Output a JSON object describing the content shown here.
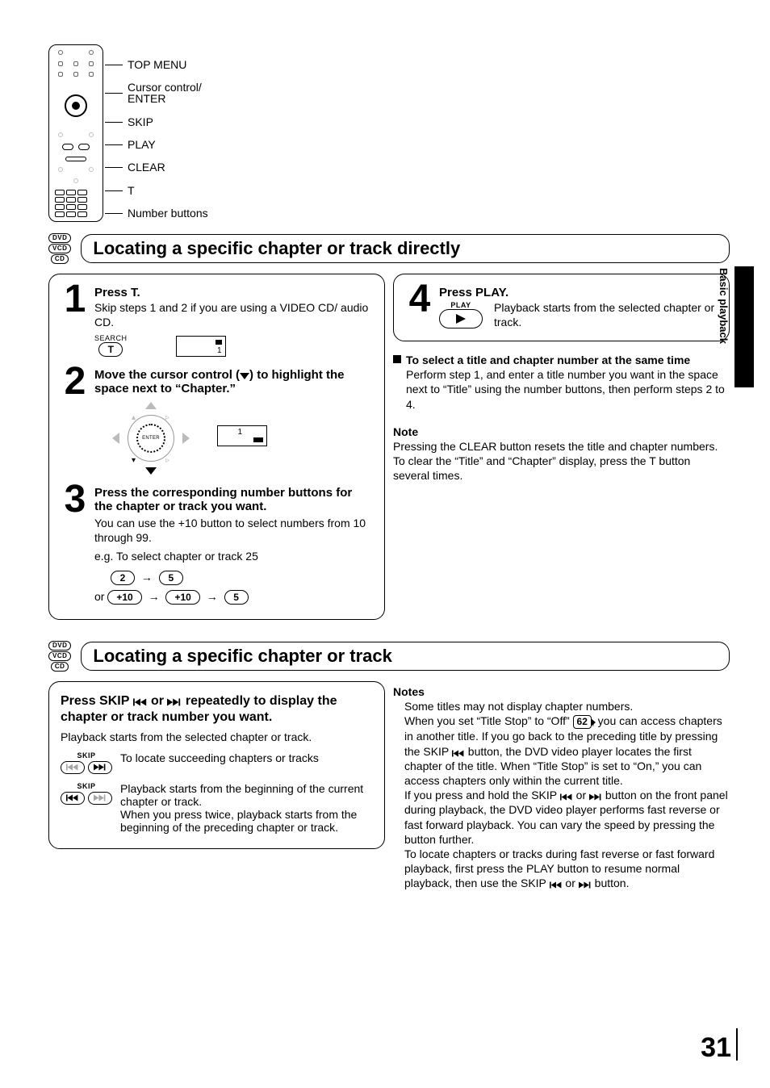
{
  "remote_labels": {
    "top_menu": "TOP MENU",
    "cursor": "Cursor control/\nENTER",
    "skip": "SKIP",
    "play": "PLAY",
    "clear": "CLEAR",
    "t": "T",
    "numbers": "Number buttons"
  },
  "badges": {
    "dvd": "DVD",
    "vcd": "VCD",
    "cd": "CD"
  },
  "section1": {
    "title": "Locating a specific chapter or track directly",
    "step1": {
      "num": "1",
      "head": "Press T.",
      "body": "Skip steps 1 and 2 if you are using a VIDEO CD/ audio CD.",
      "search": "SEARCH",
      "key": "T",
      "disp_num": "1"
    },
    "step2": {
      "num": "2",
      "head_a": "Move the cursor control (",
      "head_b": ") to highlight the space next to “Chapter.”",
      "enter": "ENTER",
      "disp_num": "1"
    },
    "step3": {
      "num": "3",
      "head": "Press the corresponding number buttons for the chapter or track you want.",
      "body1": "You can use the +10 button to select numbers from 10 through 99.",
      "body2": "e.g. To select chapter or track 25",
      "k2": "2",
      "k5": "5",
      "p10": "+10",
      "or": "or"
    },
    "step4": {
      "num": "4",
      "head": "Press PLAY.",
      "play_label": "PLAY",
      "body": "Playback starts from the selected chapter or track."
    },
    "subhead": "To select a title and chapter number at the same time",
    "subbody": "Perform step 1, and enter a title number you want in the space next to “Title” using the number buttons, then perform steps 2 to 4.",
    "note_head": "Note",
    "note_body": "Pressing the CLEAR button resets the title and chapter numbers. To clear the “Title” and “Chapter” display, press the T button several times."
  },
  "section2": {
    "title": "Locating a specific chapter or track",
    "bold_a": "Press SKIP ",
    "bold_b": " or ",
    "bold_c": " repeatedly to display the chapter or track number you want.",
    "line1": "Playback starts from the selected chapter or track.",
    "skip_small": "SKIP",
    "row1": "To locate succeeding chapters or tracks",
    "row2": "Playback starts from the beginning of the current chapter or track.\nWhen you press twice, playback starts from the beginning of the preceding chapter or track.",
    "notes_head": "Notes",
    "n1": "Some titles may not display chapter numbers.",
    "n2a": "When you set “Title Stop” to “Off” ",
    "n2_page": "62",
    "n2b": ", you can access chapters in another title. If you go back to the preceding title by pressing the SKIP ",
    "n2c": " button, the DVD video player locates the first chapter of the title.  When “Title Stop” is set to “On,” you can access chapters only within the current title.",
    "n3a": "If you press and hold the SKIP ",
    "n3b": " or ",
    "n3c": " button on the front panel during playback, the DVD video player performs fast reverse or fast forward playback.  You can vary the speed by pressing the button further.",
    "n4a": "To locate chapters or tracks during fast reverse or fast forward playback, first press the PLAY button to resume normal playback, then use the SKIP ",
    "n4b": " or ",
    "n4c": " button."
  },
  "side": "Basic playback",
  "page_number": "31"
}
